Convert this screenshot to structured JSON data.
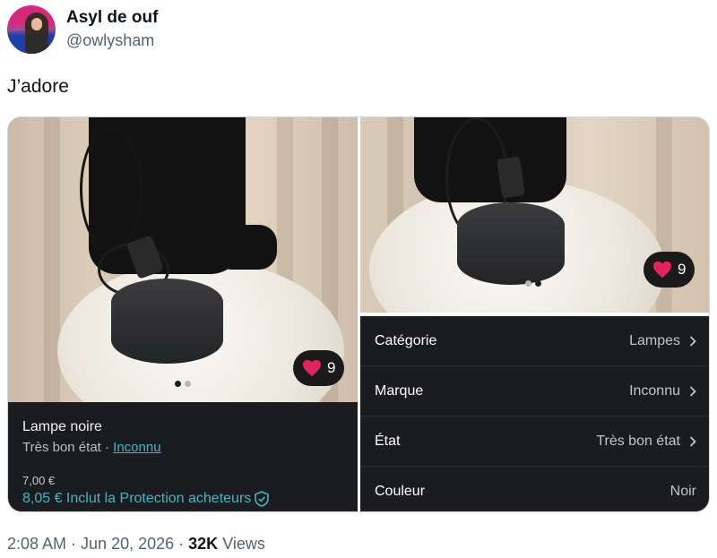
{
  "author": {
    "display_name": "Asyl de ouf",
    "handle": "@owlysham"
  },
  "tweet": {
    "text": "J’adore"
  },
  "listing": {
    "title": "Lampe noire",
    "condition": "Très bon état",
    "separator": " · ",
    "brand": "Inconnu",
    "price": "7,00 €",
    "price_with_protection": "8,05 € Inclut la Protection acheteurs",
    "likes": "9"
  },
  "details_photo": {
    "likes": "9"
  },
  "details": [
    {
      "label": "Catégorie",
      "value": "Lampes",
      "chevron": true
    },
    {
      "label": "Marque",
      "value": "Inconnu",
      "chevron": true
    },
    {
      "label": "État",
      "value": "Très bon état",
      "chevron": true
    },
    {
      "label": "Couleur",
      "value": "Noir",
      "chevron": false
    }
  ],
  "footer": {
    "time": "2:08 AM",
    "date": "Jun 20, 2026",
    "views_count": "32K",
    "views_label": "Views",
    "sep": " · "
  },
  "colors": {
    "accent_teal": "#4ab3c3",
    "heart_red": "#e0245e",
    "panel_dark": "#1b1c1f"
  },
  "icons": {
    "heart": "heart-icon",
    "shield": "shield-check-icon",
    "chevron": "chevron-right-icon"
  }
}
